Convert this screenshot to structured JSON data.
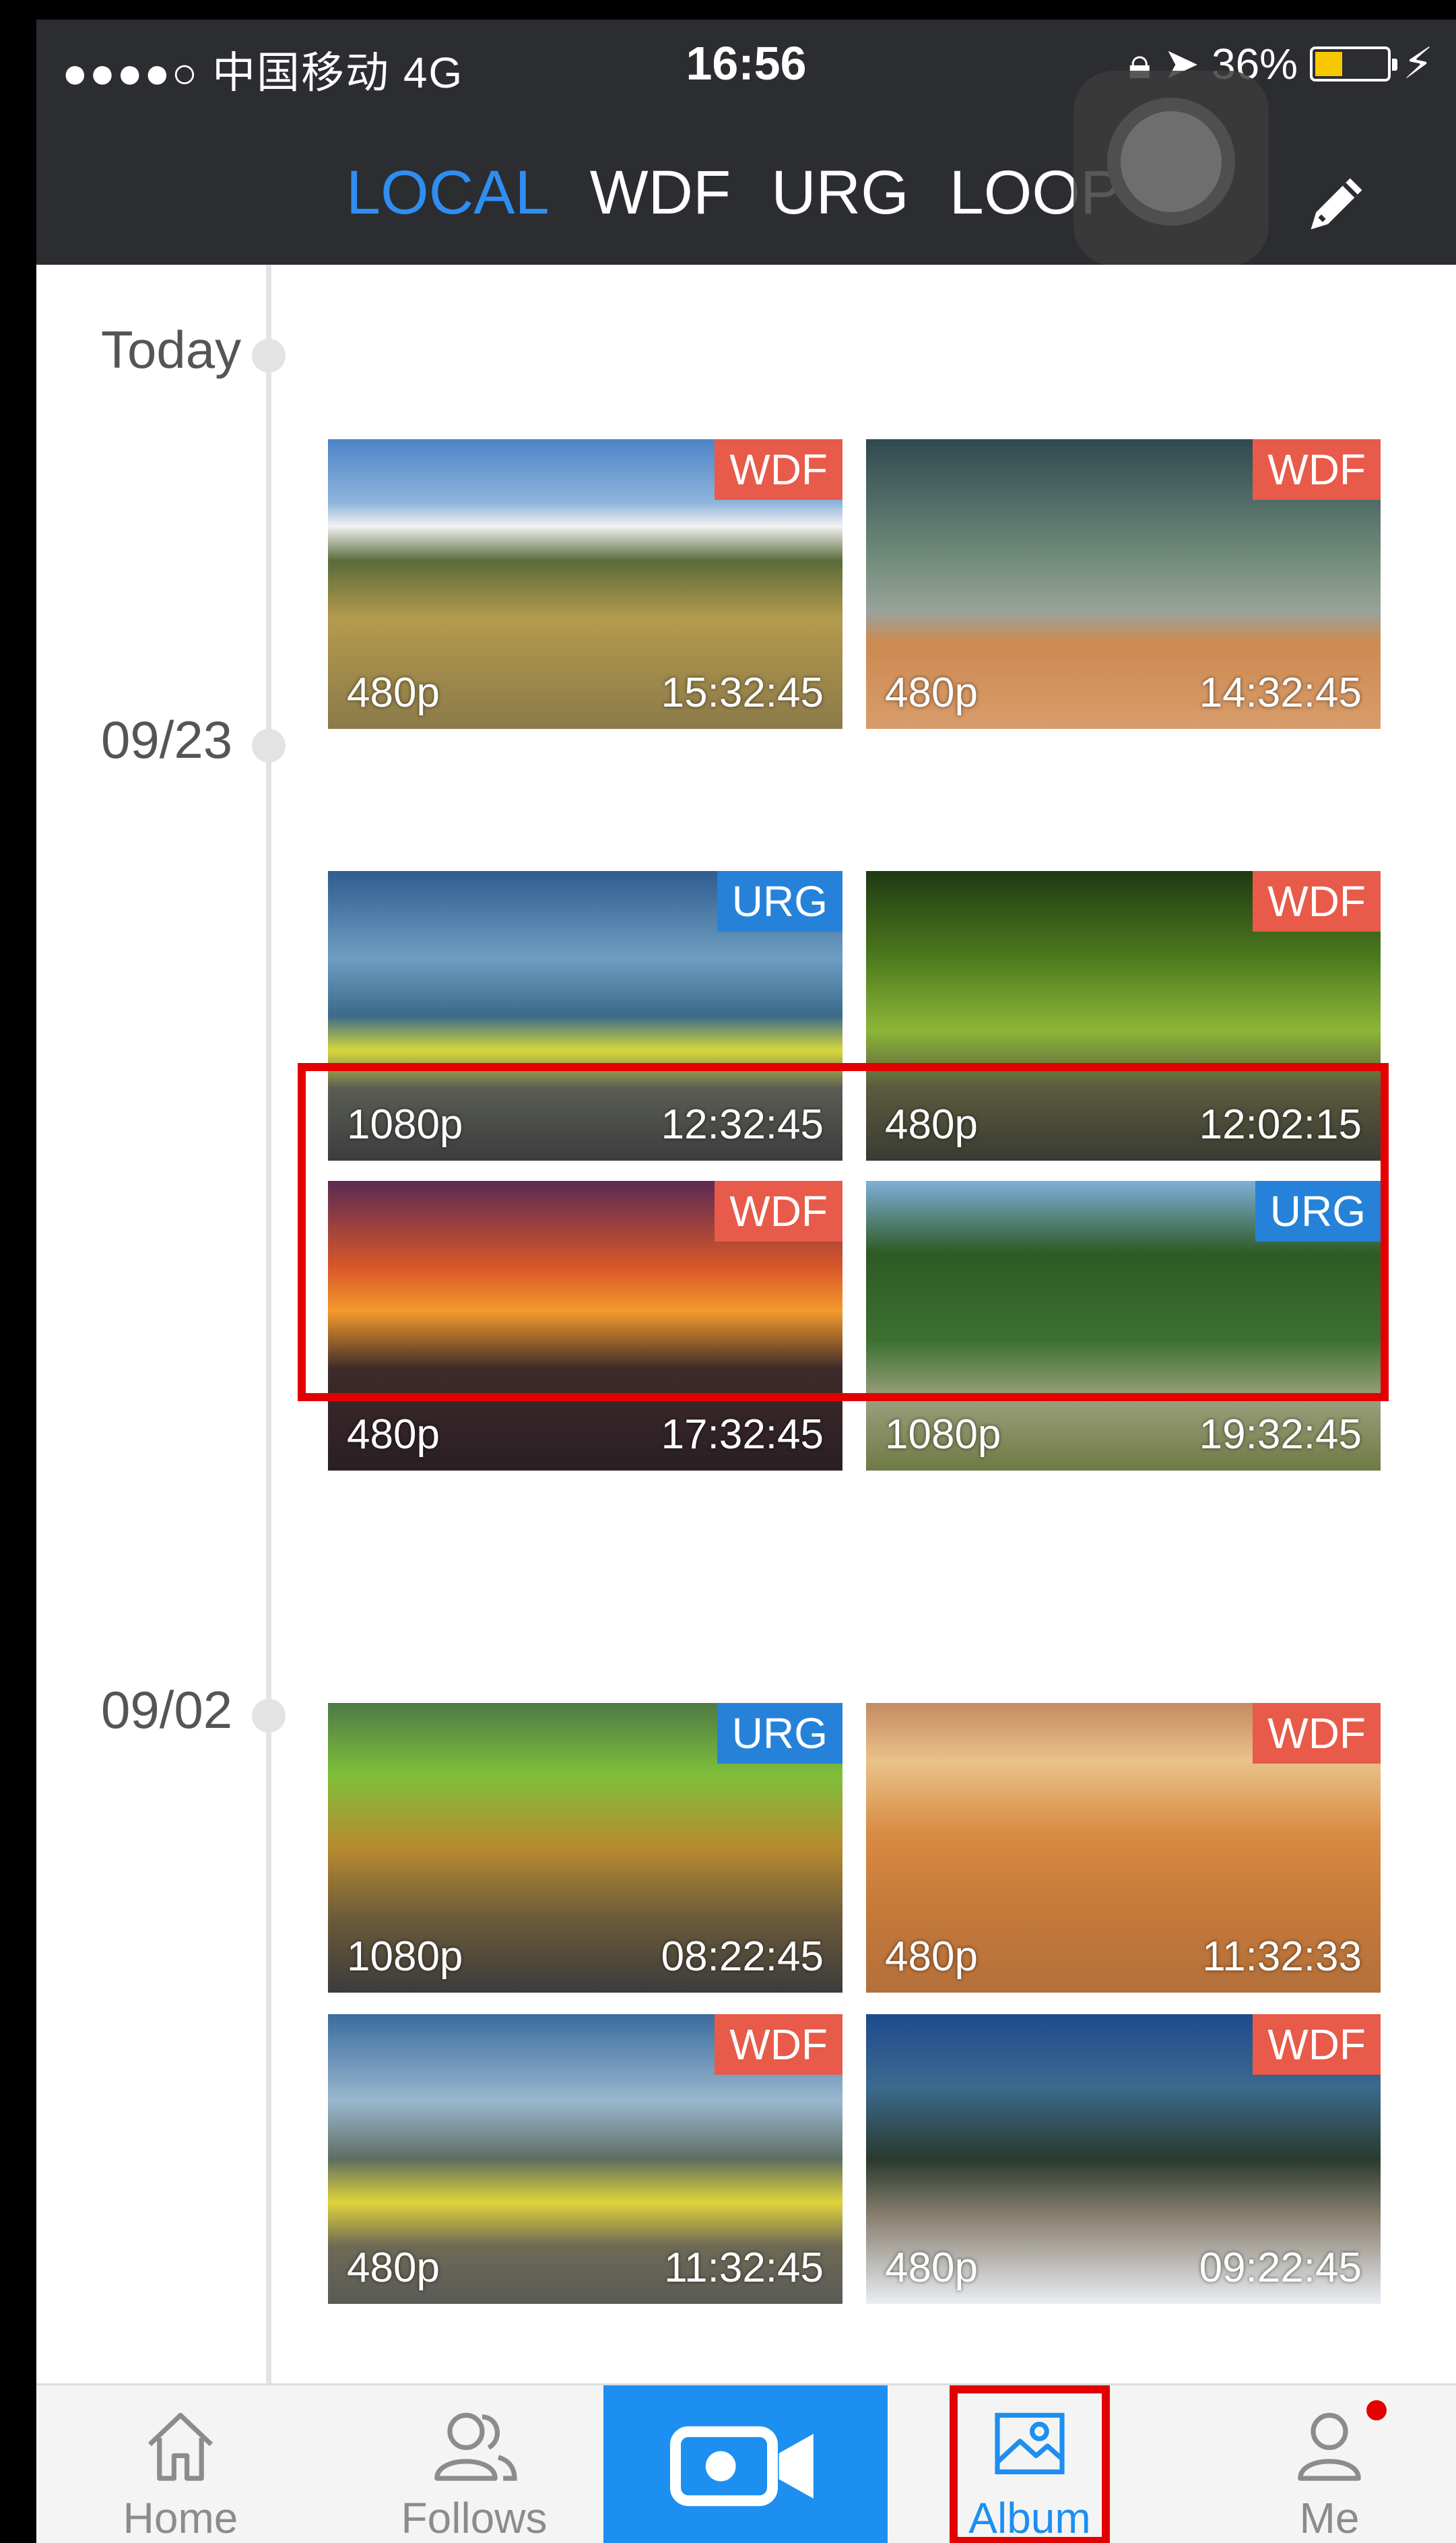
{
  "status_bar": {
    "carrier": "●●●●○ 中国移动  4G",
    "time": "16:56",
    "battery": "36%",
    "battery_level": 0.36
  },
  "tabs": [
    {
      "label": "LOCAL",
      "active": true
    },
    {
      "label": "WDF",
      "active": false
    },
    {
      "label": "URG",
      "active": false
    },
    {
      "label": "LOOP",
      "active": false
    }
  ],
  "sections": [
    {
      "date": "Today"
    },
    {
      "date": "09/23"
    },
    {
      "date": "09/02"
    }
  ],
  "videos": [
    {
      "tag": "WDF",
      "tag_type": "wdf",
      "resolution": "480p",
      "time": "15:32:45",
      "scene": "mountain road"
    },
    {
      "tag": "WDF",
      "tag_type": "wdf",
      "resolution": "480p",
      "time": "14:32:45",
      "scene": "boat on beach"
    },
    {
      "tag": "URG",
      "tag_type": "urg",
      "resolution": "1080p",
      "time": "12:32:45",
      "scene": "highway plain"
    },
    {
      "tag": "WDF",
      "tag_type": "wdf",
      "resolution": "480p",
      "time": "12:02:15",
      "scene": "tree tunnel"
    },
    {
      "tag": "WDF",
      "tag_type": "wdf",
      "resolution": "480p",
      "time": "17:32:45",
      "scene": "sunset highway"
    },
    {
      "tag": "URG",
      "tag_type": "urg",
      "resolution": "1080p",
      "time": "19:32:45",
      "scene": "forest curve"
    },
    {
      "tag": "URG",
      "tag_type": "urg",
      "resolution": "1080p",
      "time": "08:22:45",
      "scene": "autumn valley"
    },
    {
      "tag": "WDF",
      "tag_type": "wdf",
      "resolution": "480p",
      "time": "11:32:33",
      "scene": "desert road"
    },
    {
      "tag": "WDF",
      "tag_type": "wdf",
      "resolution": "480p",
      "time": "11:32:45",
      "scene": "yellow fields"
    },
    {
      "tag": "WDF",
      "tag_type": "wdf",
      "resolution": "480p",
      "time": "09:22:45",
      "scene": "snowy road"
    }
  ],
  "bottom_nav": [
    {
      "label": "Home",
      "icon": "home-icon"
    },
    {
      "label": "Follows",
      "icon": "follows-icon"
    },
    {
      "label": "",
      "icon": "camera-icon"
    },
    {
      "label": "Album",
      "icon": "album-icon",
      "active": true
    },
    {
      "label": "Me",
      "icon": "me-icon",
      "badge": true
    }
  ],
  "colors": {
    "accent": "#2f8ef1",
    "topbar": "#2b2d31",
    "wdf_tag": "#e85a4a",
    "urg_tag": "#2582d8",
    "highlight": "#e30000",
    "camera_button": "#1d8ff0"
  }
}
